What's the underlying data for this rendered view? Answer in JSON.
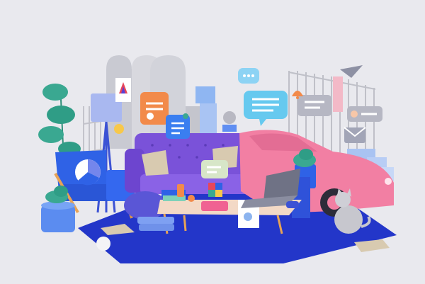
{
  "scene": {
    "kind": "3d-illustration",
    "theme": "isometric living room with floating chat and UI icons",
    "palette": {
      "background": "#e9e9ee",
      "rug": "#2336c9",
      "sofa": "#7a52d9",
      "car": "#f27fa3",
      "armchair": "#2f62e6",
      "chat_bubble": "#66c9ef",
      "accent_orange": "#f28a4a",
      "plant": "#3aa891"
    },
    "icons": [
      "chat-bubble-icon",
      "contact-card-icon",
      "document-icon",
      "paper-plane-icon",
      "envelope-icon",
      "bell-icon",
      "pie-chart-icon",
      "notification-card-icon"
    ],
    "objects": [
      "sofa",
      "armchair",
      "coffee-table",
      "laptop",
      "sports-car",
      "floor-lamp",
      "potted-plants",
      "cat",
      "rug",
      "pillows",
      "rubik-cube",
      "bean-bag",
      "arched-panels",
      "picket-fence"
    ]
  }
}
